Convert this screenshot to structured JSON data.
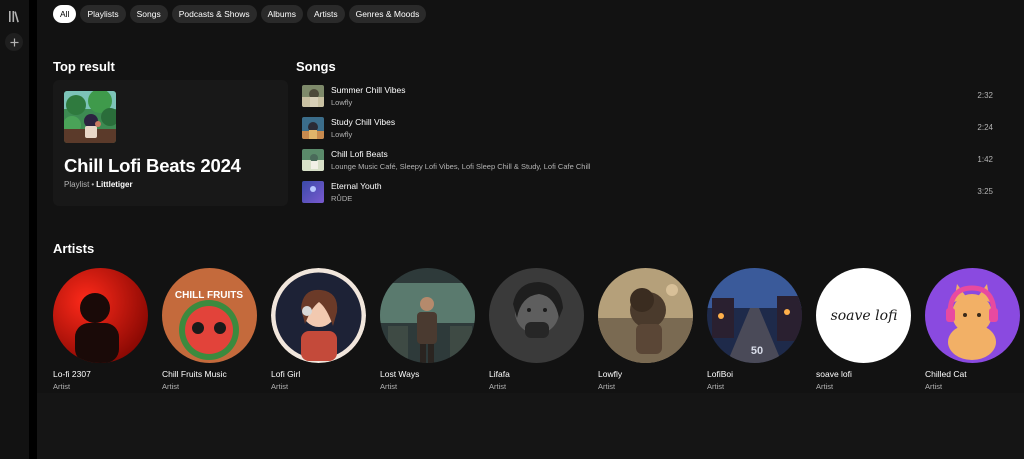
{
  "filters": [
    "All",
    "Playlists",
    "Songs",
    "Podcasts & Shows",
    "Albums",
    "Artists",
    "Genres & Moods"
  ],
  "top_result": {
    "heading": "Top result",
    "title": "Chill Lofi Beats 2024",
    "type": "Playlist",
    "separator": "•",
    "owner": "Littletiger"
  },
  "songs": {
    "heading": "Songs",
    "items": [
      {
        "title": "Summer Chill Vibes",
        "artist": "Lowfly",
        "duration": "2:32"
      },
      {
        "title": "Study Chill Vibes",
        "artist": "Lowfly",
        "duration": "2:24"
      },
      {
        "title": "Chill Lofi Beats",
        "artist": "Lounge Music Café, Sleepy Lofi Vibes, Lofi Sleep Chill & Study, Lofi Cafe Chill",
        "duration": "1:42"
      },
      {
        "title": "Eternal Youth",
        "artist": "RŮDE",
        "duration": "3:25"
      }
    ]
  },
  "artists": {
    "heading": "Artists",
    "items": [
      {
        "name": "Lo-fi 2307",
        "type": "Artist"
      },
      {
        "name": "Chill Fruits Music",
        "type": "Artist",
        "logo_text": "CHILL FRUITS"
      },
      {
        "name": "Lofi Girl",
        "type": "Artist"
      },
      {
        "name": "Lost Ways",
        "type": "Artist"
      },
      {
        "name": "Lifafa",
        "type": "Artist"
      },
      {
        "name": "Lowfly",
        "type": "Artist"
      },
      {
        "name": "LofiBoi",
        "type": "Artist",
        "logo_text": "50"
      },
      {
        "name": "soave lofi",
        "type": "Artist",
        "logo_text": "soave lofi"
      },
      {
        "name": "Chilled Cat",
        "type": "Artist"
      }
    ]
  },
  "icons": {
    "library": "library-icon",
    "add": "plus-icon"
  }
}
